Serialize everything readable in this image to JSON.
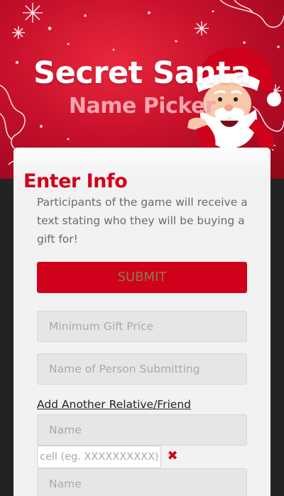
{
  "hero": {
    "title": "Secret Santa",
    "subtitle": "Name Picker"
  },
  "form": {
    "heading": "Enter Info",
    "description": "Participants of the game will receive a text stating who they will be buying a gift for!",
    "submit_label": "SUBMIT",
    "min_price_placeholder": "Minimum Gift Price",
    "submitter_placeholder": "Name of Person Submitting",
    "add_link_label": "Add Another Relative/Friend",
    "entry_name_placeholder": "Name",
    "entry_cell_placeholder": "cell (eg. XXXXXXXXXX)",
    "remove_glyph": "✖",
    "next_name_placeholder": "Name"
  },
  "colors": {
    "accent": "#d0021b",
    "hero_bg": "#c8102b",
    "page_bg": "#222325",
    "card_bg": "#f2f2f2"
  }
}
